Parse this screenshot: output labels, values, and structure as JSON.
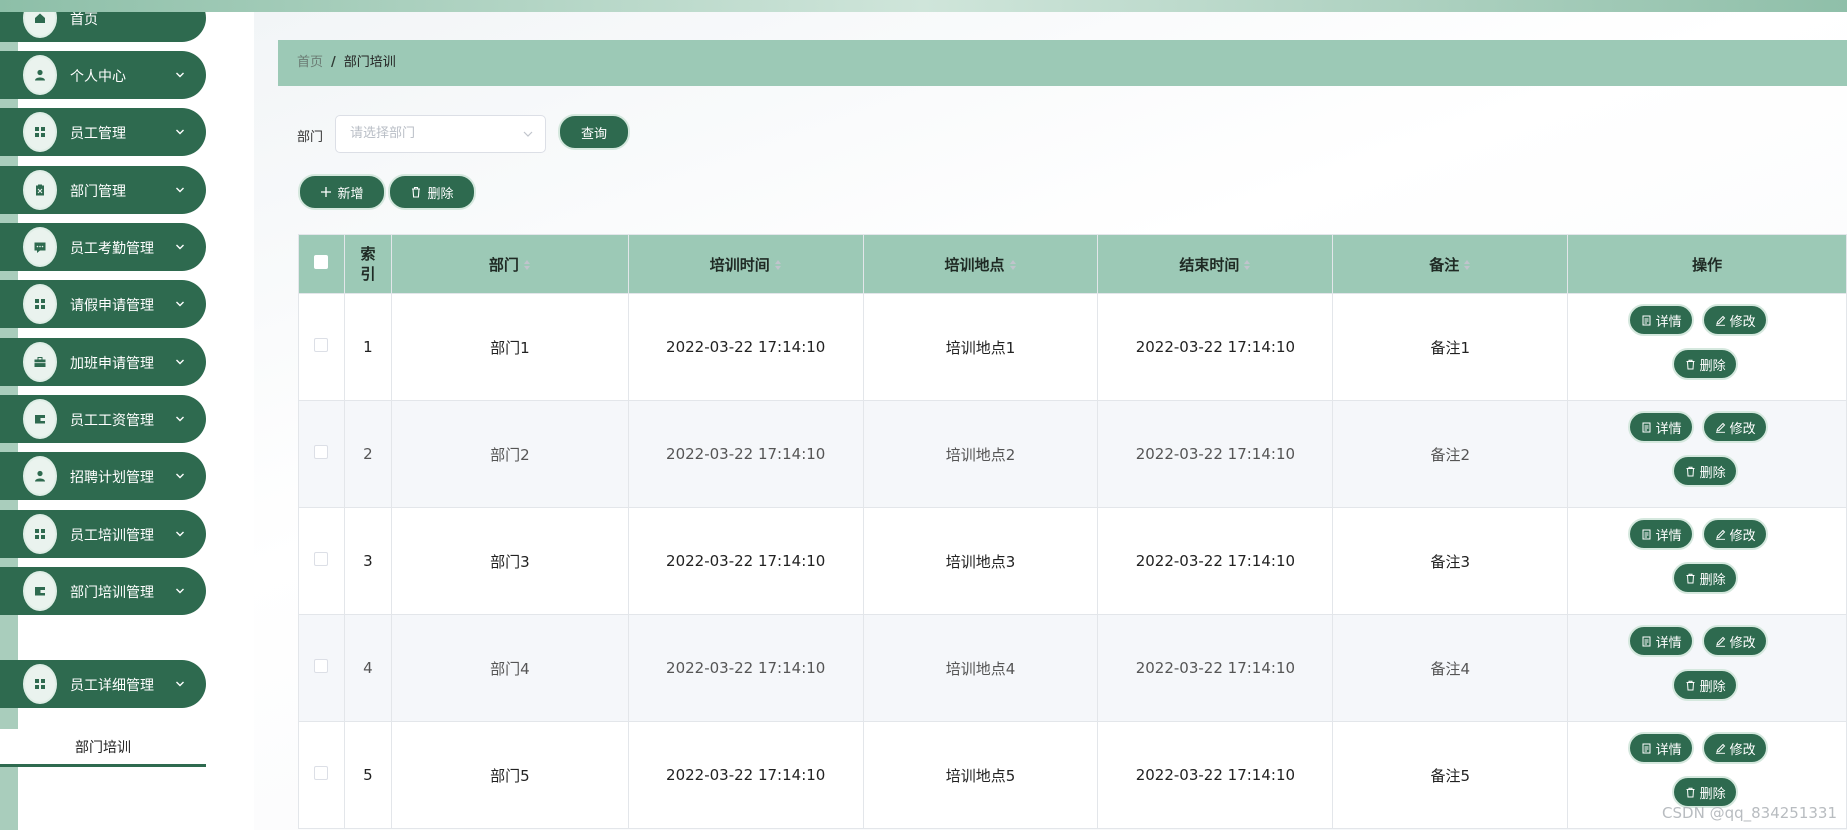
{
  "sidebar": {
    "items": [
      {
        "label": "首页",
        "icon": "home-icon",
        "has_chevron": false
      },
      {
        "label": "个人中心",
        "icon": "user-icon",
        "has_chevron": true
      },
      {
        "label": "员工管理",
        "icon": "grid-icon",
        "has_chevron": true
      },
      {
        "label": "部门管理",
        "icon": "clipboard-icon",
        "has_chevron": true
      },
      {
        "label": "员工考勤管理",
        "icon": "chat-icon",
        "has_chevron": true
      },
      {
        "label": "请假申请管理",
        "icon": "grid-icon",
        "has_chevron": true
      },
      {
        "label": "加班申请管理",
        "icon": "briefcase-icon",
        "has_chevron": true
      },
      {
        "label": "员工工资管理",
        "icon": "wallet-icon",
        "has_chevron": true
      },
      {
        "label": "招聘计划管理",
        "icon": "user-icon",
        "has_chevron": true
      },
      {
        "label": "员工培训管理",
        "icon": "grid-icon",
        "has_chevron": true
      },
      {
        "label": "部门培训管理",
        "icon": "wallet-icon",
        "has_chevron": true
      },
      {
        "label": "员工详细管理",
        "icon": "grid-icon",
        "has_chevron": true
      }
    ],
    "submenu_active": "部门培训"
  },
  "breadcrumb": {
    "home": "首页",
    "separator": "/",
    "current": "部门培训"
  },
  "filter": {
    "label": "部门",
    "placeholder": "请选择部门",
    "query_button": "查询"
  },
  "actions": {
    "add": "新增",
    "delete": "删除"
  },
  "table": {
    "headers": {
      "index": "索\n引",
      "department": "部门",
      "training_time": "培训时间",
      "location": "培训地点",
      "end_time": "结束时间",
      "remark": "备注",
      "operations": "操作"
    },
    "rows": [
      {
        "index": "1",
        "department": "部门1",
        "training_time": "2022-03-22 17:14:10",
        "location": "培训地点1",
        "end_time": "2022-03-22 17:14:10",
        "remark": "备注1"
      },
      {
        "index": "2",
        "department": "部门2",
        "training_time": "2022-03-22 17:14:10",
        "location": "培训地点2",
        "end_time": "2022-03-22 17:14:10",
        "remark": "备注2"
      },
      {
        "index": "3",
        "department": "部门3",
        "training_time": "2022-03-22 17:14:10",
        "location": "培训地点3",
        "end_time": "2022-03-22 17:14:10",
        "remark": "备注3"
      },
      {
        "index": "4",
        "department": "部门4",
        "training_time": "2022-03-22 17:14:10",
        "location": "培训地点4",
        "end_time": "2022-03-22 17:14:10",
        "remark": "备注4"
      },
      {
        "index": "5",
        "department": "部门5",
        "training_time": "2022-03-22 17:14:10",
        "location": "培训地点5",
        "end_time": "2022-03-22 17:14:10",
        "remark": "备注5"
      }
    ],
    "row_actions": {
      "detail": "详情",
      "edit": "修改",
      "delete": "删除"
    }
  },
  "watermark": "CSDN @qq_834251331",
  "colors": {
    "primary": "#2e6a4f",
    "header_bg": "#9cc9b6",
    "accent_light": "#a9cdbc"
  }
}
